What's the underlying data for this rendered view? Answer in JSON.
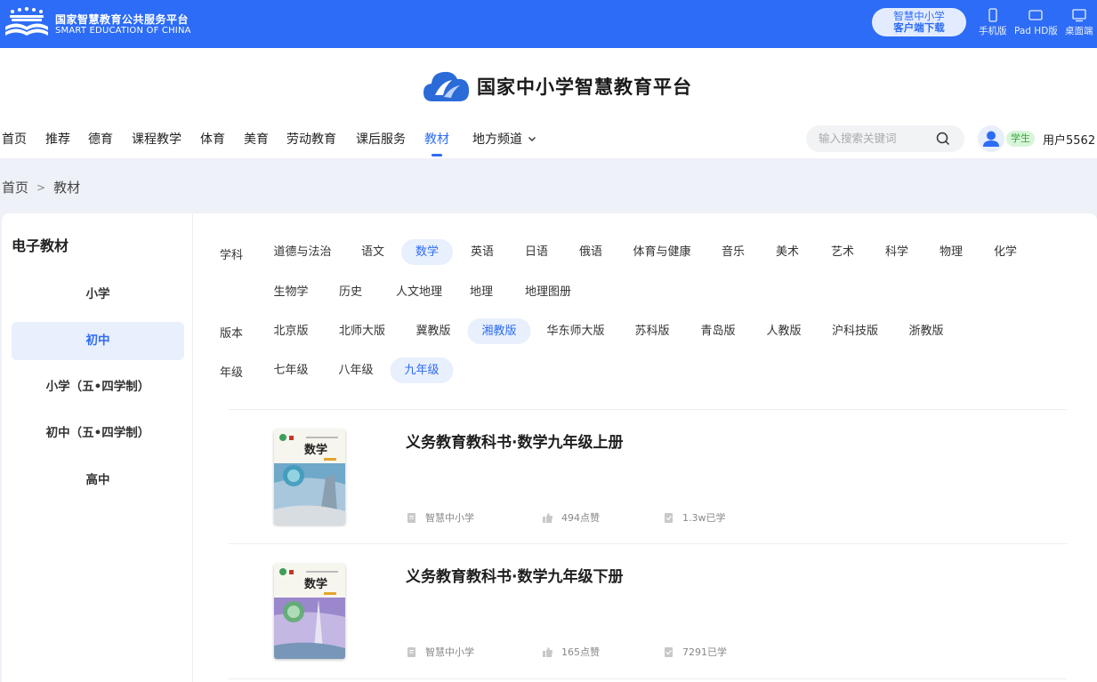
{
  "topbar": {
    "title_cn": "国家智慧教育公共服务平台",
    "title_en": "SMART EDUCATION OF CHINA",
    "download_line1": "智慧中小学",
    "download_line2": "客户端下载",
    "devices": [
      {
        "label": "手机版",
        "icon": "phone-icon"
      },
      {
        "label": "Pad HD版",
        "icon": "tablet-icon"
      },
      {
        "label": "桌面端",
        "icon": "desktop-icon"
      }
    ],
    "color": "#2d6cf6"
  },
  "header": {
    "brand": "国家中小学智慧教育平台",
    "nav": [
      "首页",
      "推荐",
      "德育",
      "课程教学",
      "体育",
      "美育",
      "劳动教育",
      "课后服务",
      "教材",
      "地方频道"
    ],
    "nav_active": "教材",
    "search_placeholder": "输入搜索关键词",
    "role_badge": "学生",
    "username": "用户5562"
  },
  "breadcrumb": {
    "home": "首页",
    "sep": ">",
    "current": "教材"
  },
  "sidebar": {
    "title": "电子教材",
    "items": [
      "小学",
      "初中",
      "小学（五•四学制）",
      "初中（五•四学制）",
      "高中"
    ],
    "active": "初中"
  },
  "filters": {
    "subject_label": "学科",
    "subjects": [
      "道德与法治",
      "语文",
      "数学",
      "英语",
      "日语",
      "俄语",
      "体育与健康",
      "音乐",
      "美术",
      "艺术",
      "科学",
      "物理",
      "化学",
      "生物学",
      "历史",
      "人文地理",
      "地理",
      "地理图册"
    ],
    "subject_active": "数学",
    "edition_label": "版本",
    "editions": [
      "北京版",
      "北师大版",
      "冀教版",
      "湘教版",
      "华东师大版",
      "苏科版",
      "青岛版",
      "人教版",
      "沪科技版",
      "浙教版"
    ],
    "edition_active": "湘教版",
    "grade_label": "年级",
    "grades": [
      "七年级",
      "八年级",
      "九年级"
    ],
    "grade_active": "九年级"
  },
  "books": [
    {
      "title": "义务教育教科书·数学九年级上册",
      "source": "智慧中小学",
      "likes": "494点赞",
      "learned": "1.3w已学",
      "cover_text": "数学",
      "cover_color": "#3f9bbd"
    },
    {
      "title": "义务教育教科书·数学九年级下册",
      "source": "智慧中小学",
      "likes": "165点赞",
      "learned": "7291已学",
      "cover_text": "数学",
      "cover_color": "#8b6cc2"
    }
  ]
}
